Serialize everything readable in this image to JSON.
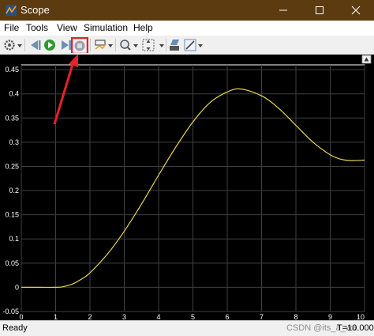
{
  "window": {
    "title": "Scope"
  },
  "menu": [
    {
      "label": "File"
    },
    {
      "label": "Tools"
    },
    {
      "label": "View"
    },
    {
      "label": "Simulation"
    },
    {
      "label": "Help"
    }
  ],
  "toolbar": {
    "icons": [
      "gear-icon",
      "step-back-icon",
      "run-icon",
      "step-forward-icon",
      "stop-icon",
      "highlight-icon",
      "zoom-icon",
      "fit-icon",
      "style-icon",
      "edit-icon"
    ],
    "highlighted": "stop-icon",
    "highlight_color": "#e8202a"
  },
  "chart_data": {
    "type": "line",
    "x": [
      0,
      0.5,
      1,
      1.2,
      1.5,
      1.8,
      2,
      2.5,
      3,
      3.5,
      4,
      4.5,
      5,
      5.5,
      6,
      6.4,
      7,
      7.5,
      8,
      8.5,
      9,
      9.3,
      9.6,
      10
    ],
    "series": [
      {
        "values": [
          0,
          0,
          0,
          0.001,
          0.007,
          0.019,
          0.03,
          0.068,
          0.116,
          0.172,
          0.232,
          0.29,
          0.342,
          0.382,
          0.404,
          0.41,
          0.396,
          0.37,
          0.335,
          0.3,
          0.274,
          0.265,
          0.262,
          0.263
        ],
        "color": "#e8d648"
      }
    ],
    "xlim": [
      0,
      10
    ],
    "ylim": [
      -0.05,
      0.46
    ],
    "x_ticks": [
      "0",
      "1",
      "2",
      "3",
      "4",
      "5",
      "6",
      "7",
      "8",
      "9",
      "10"
    ],
    "y_ticks": [
      "-0.05",
      "0",
      "0.05",
      "0.1",
      "0.15",
      "0.2",
      "0.25",
      "0.3",
      "0.35",
      "0.4",
      "0.45"
    ],
    "grid": true,
    "background": "#000000",
    "axis_color": "#ffffff"
  },
  "status": {
    "text": "Ready",
    "watermark": "CSDN @its_a_wa",
    "time": "T=10.000"
  }
}
